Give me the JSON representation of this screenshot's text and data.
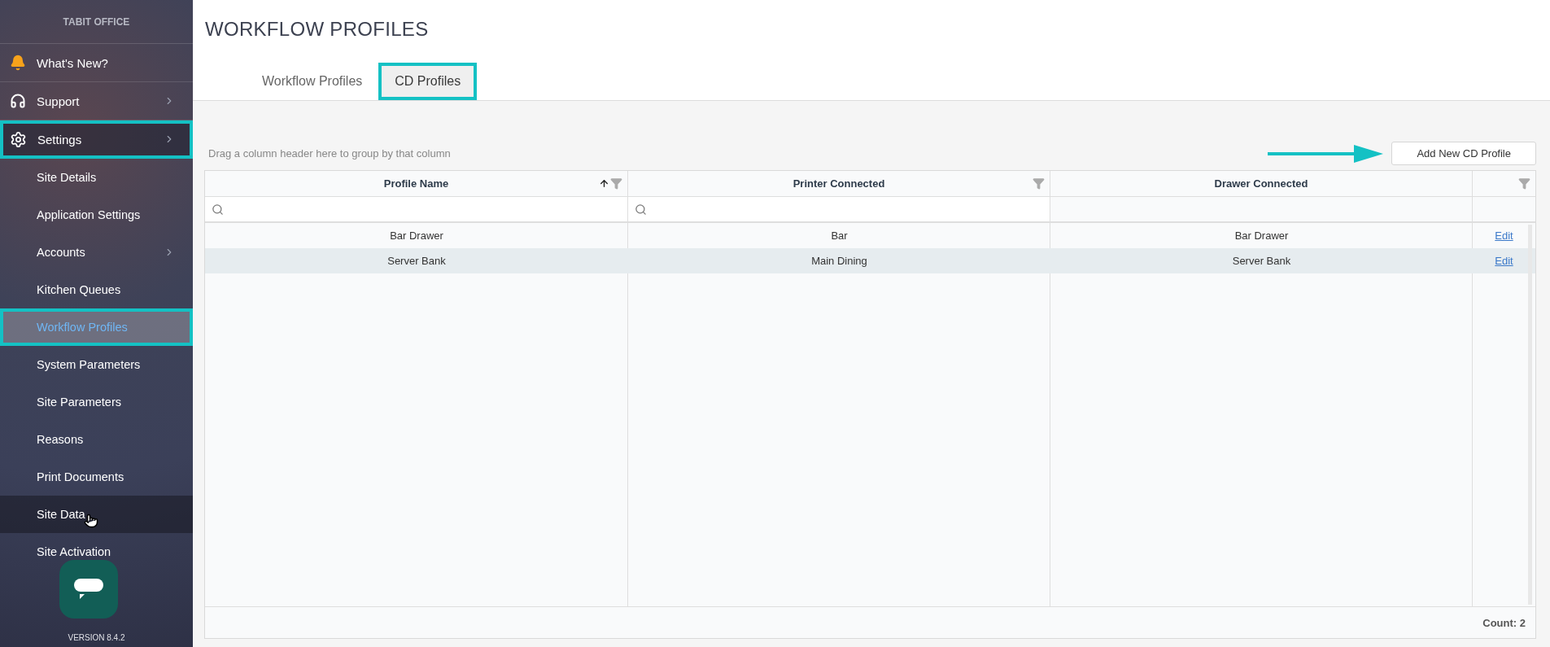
{
  "sidebar": {
    "brand": "TABIT OFFICE",
    "items": [
      {
        "label": "What's New?",
        "has_submenu": false,
        "highlighted": false
      },
      {
        "label": "Support",
        "has_submenu": true,
        "highlighted": false
      },
      {
        "label": "Settings",
        "has_submenu": true,
        "highlighted": true,
        "children": [
          {
            "label": "Site Details",
            "has_submenu": false,
            "selected": false,
            "hovered": false,
            "highlighted": false
          },
          {
            "label": "Application Settings",
            "has_submenu": false,
            "selected": false,
            "hovered": false,
            "highlighted": false
          },
          {
            "label": "Accounts",
            "has_submenu": true,
            "selected": false,
            "hovered": false,
            "highlighted": false
          },
          {
            "label": "Kitchen Queues",
            "has_submenu": false,
            "selected": false,
            "hovered": false,
            "highlighted": false
          },
          {
            "label": "Workflow Profiles",
            "has_submenu": false,
            "selected": true,
            "hovered": false,
            "highlighted": true
          },
          {
            "label": "System Parameters",
            "has_submenu": false,
            "selected": false,
            "hovered": false,
            "highlighted": false
          },
          {
            "label": "Site Parameters",
            "has_submenu": false,
            "selected": false,
            "hovered": false,
            "highlighted": false
          },
          {
            "label": "Reasons",
            "has_submenu": false,
            "selected": false,
            "hovered": false,
            "highlighted": false
          },
          {
            "label": "Print Documents",
            "has_submenu": false,
            "selected": false,
            "hovered": false,
            "highlighted": false
          },
          {
            "label": "Site Data",
            "has_submenu": false,
            "selected": false,
            "hovered": true,
            "highlighted": false
          },
          {
            "label": "Site Activation",
            "has_submenu": false,
            "selected": false,
            "hovered": false,
            "highlighted": false
          }
        ]
      }
    ],
    "version": "VERSION 8.4.2"
  },
  "page_title": "WORKFLOW PROFILES",
  "tabs": [
    {
      "label": "Workflow Profiles",
      "selected": false,
      "highlighted": false
    },
    {
      "label": "CD Profiles",
      "selected": true,
      "highlighted": true
    }
  ],
  "group_hint": "Drag a column header here to group by that column",
  "add_button": {
    "label": "Add New CD Profile",
    "pointed_at": true
  },
  "table": {
    "columns": [
      {
        "title": "Profile Name",
        "sorted_ascending": true,
        "filter": true,
        "searchable": true
      },
      {
        "title": "Printer Connected",
        "sorted_ascending": false,
        "filter": true,
        "searchable": true
      },
      {
        "title": "Drawer Connected",
        "sorted_ascending": false,
        "filter": false,
        "searchable": false
      },
      {
        "sorted_ascending": false,
        "filter": true,
        "searchable": false
      }
    ],
    "rows": [
      {
        "cells": [
          "Bar Drawer",
          "Bar",
          "Bar Drawer"
        ],
        "action": "Edit",
        "selected": false
      },
      {
        "cells": [
          "Server Bank",
          "Main Dining",
          "Server Bank"
        ],
        "action": "Edit",
        "selected": true
      }
    ],
    "count": "Count: 2"
  }
}
